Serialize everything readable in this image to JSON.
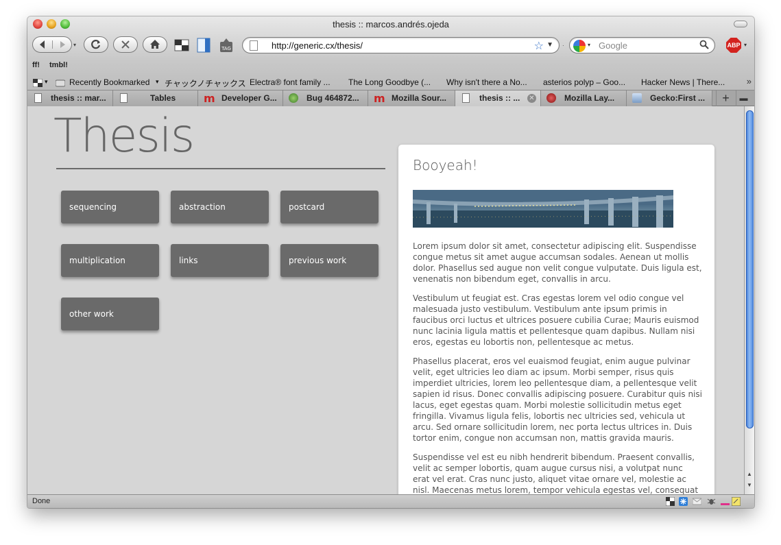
{
  "window": {
    "title": "thesis :: marcos.andrés.ojeda"
  },
  "navbar": {
    "url": "http://generic.cx/thesis/",
    "search_placeholder": "Google",
    "adblock_label": "ABP"
  },
  "personal_bar": {
    "items": [
      "ff!",
      "tmbl!"
    ]
  },
  "bookmarks": {
    "items": [
      "Recently Bookmarked",
      "チャックノチャックス",
      "Electra® font family ...",
      "The Long Goodbye (...",
      "Why isn't there a No...",
      "asterios polyp – Goo...",
      "Hacker News | There..."
    ]
  },
  "tabs": {
    "items": [
      {
        "label": "thesis :: mar...",
        "icon": "page-icon"
      },
      {
        "label": "Tables",
        "icon": "page-icon"
      },
      {
        "label": "Developer G...",
        "icon": "mdc-m-icon"
      },
      {
        "label": "Bug 464872...",
        "icon": "bugzilla-icon"
      },
      {
        "label": "Mozilla Sour...",
        "icon": "mdc-m-icon"
      },
      {
        "label": "thesis :: ...",
        "icon": "page-icon",
        "active": true
      },
      {
        "label": "Mozilla Lay...",
        "icon": "mozilla-dino-icon"
      },
      {
        "label": "Gecko:First ...",
        "icon": "wiki-icon"
      }
    ]
  },
  "page": {
    "title": "Thesis",
    "tiles": [
      "sequencing",
      "abstraction",
      "postcard",
      "multiplication",
      "links",
      "previous work",
      "other work"
    ],
    "panel": {
      "heading": "Booyeah!",
      "paragraphs": [
        "Lorem ipsum dolor sit amet, consectetur adipiscing elit. Suspendisse congue metus sit amet augue accumsan sodales. Aenean ut mollis dolor. Phasellus sed augue non velit congue vulputate. Duis ligula est, venenatis non bibendum eget, convallis in arcu.",
        "Vestibulum ut feugiat est. Cras egestas lorem vel odio congue vel malesuada justo vestibulum. Vestibulum ante ipsum primis in faucibus orci luctus et ultrices posuere cubilia Curae; Mauris euismod nunc lacinia ligula mattis et pellentesque quam dapibus. Nullam nisi eros, egestas eu lobortis non, pellentesque ac metus.",
        "Phasellus placerat, eros vel euaismod feugiat, enim augue pulvinar velit, eget ultricies leo diam ac ipsum. Morbi semper, risus quis imperdiet ultricies, lorem leo pellentesque diam, a pellentesque velit sapien id risus. Donec convallis adipiscing posuere. Curabitur quis nisi lacus, eget egestas quam. Morbi molestie sollicitudin metus eget fringilla. Vivamus ligula felis, lobortis nec ultricies sed, vehicula ut arcu. Sed ornare sollicitudin lorem, nec porta lectus ultrices in. Duis tortor enim, congue non accumsan non, mattis gravida mauris.",
        "Suspendisse vel est eu nibh hendrerit bibendum. Praesent convallis, velit ac semper lobortis, quam augue cursus nisi, a volutpat nunc erat vel erat. Cras nunc justo, aliquet vitae ornare vel, molestie ac nisl. Maecenas metus lorem, tempor vehicula egestas vel, consequat in tortor. Mauris eu nulla sit amet"
      ]
    }
  },
  "statusbar": {
    "text": "Done"
  },
  "colors": {
    "tile": "#6a6a6a",
    "page_bg": "#d6d6d6",
    "scroll_thumb": "#4a86e0"
  }
}
